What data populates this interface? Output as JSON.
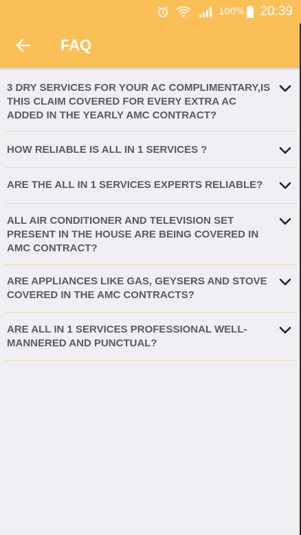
{
  "status_bar": {
    "icons": [
      "alarm-icon",
      "wifi-icon",
      "signal-icon",
      "battery-icon"
    ],
    "battery": "100%",
    "time": "20:39"
  },
  "header": {
    "back_icon": "arrow-left-icon",
    "title": "FAQ",
    "color": "#fbbf57"
  },
  "faqs": [
    {
      "question": "3 DRY SERVICES FOR YOUR AC COMPLIMENTARY,IS THIS CLAIM COVERED FOR EVERY EXTRA AC ADDED IN THE YEARLY AMC CONTRACT?",
      "expanded": false
    },
    {
      "question": "HOW RELIABLE IS ALL IN 1 SERVICES ?",
      "expanded": false
    },
    {
      "question": "ARE THE ALL IN 1 SERVICES EXPERTS RELIABLE?",
      "expanded": false
    },
    {
      "question": "ALL AIR CONDITIONER AND TELEVISION SET PRESENT IN THE HOUSE ARE BEING COVERED IN AMC CONTRACT?",
      "expanded": false
    },
    {
      "question": "ARE APPLIANCES LIKE GAS, GEYSERS AND STOVE COVERED IN THE AMC CONTRACTS?",
      "expanded": false
    },
    {
      "question": "ARE ALL IN 1 SERVICES PROFESSIONAL WELL-MANNERED AND PUNCTUAL?",
      "expanded": false
    }
  ]
}
